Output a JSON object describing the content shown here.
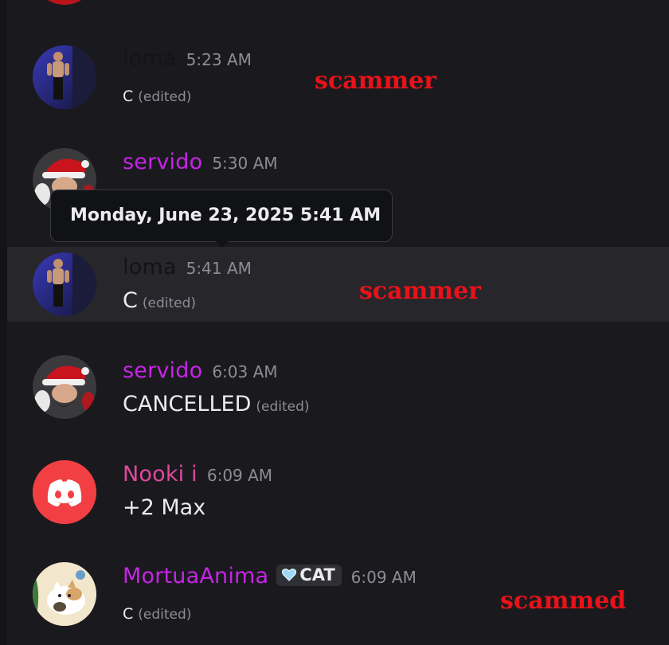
{
  "colors": {
    "background": "#1a1a1e",
    "username_loma": "#141414",
    "username_servido": "#c624e6",
    "username_nooki": "#e0479e",
    "username_mortua": "#c624e6",
    "annotation": "#e8121a",
    "discord_red": "#f23f43"
  },
  "tooltip": {
    "text": "Monday, June 23, 2025 5:41 AM"
  },
  "messages": [
    {
      "author": "loma",
      "time": "5:23 AM",
      "content": "C",
      "edited": "(edited)",
      "annotation": "scammer",
      "avatar_icon": "user-photo-avatar"
    },
    {
      "author": "servido",
      "time": "5:30 AM",
      "content": "",
      "edited": "",
      "avatar_icon": "santa-illustration-avatar"
    },
    {
      "author": "loma",
      "time": "5:41 AM",
      "content": "C",
      "edited": "(edited)",
      "annotation": "scammer",
      "avatar_icon": "user-photo-avatar"
    },
    {
      "author": "servido",
      "time": "6:03 AM",
      "content": "CANCELLED",
      "edited": "(edited)",
      "avatar_icon": "santa-illustration-avatar"
    },
    {
      "author": "Nooki i",
      "time": "6:09 AM",
      "content": "+2 Max",
      "edited": "",
      "avatar_icon": "discord-logo-icon"
    },
    {
      "author": "MortuaAnima",
      "tag": "CAT",
      "tag_icon": "heart-icon",
      "time": "6:09 AM",
      "content": "C",
      "edited": "(edited)",
      "annotation": "scammed",
      "avatar_icon": "cat-illustration-avatar"
    }
  ]
}
